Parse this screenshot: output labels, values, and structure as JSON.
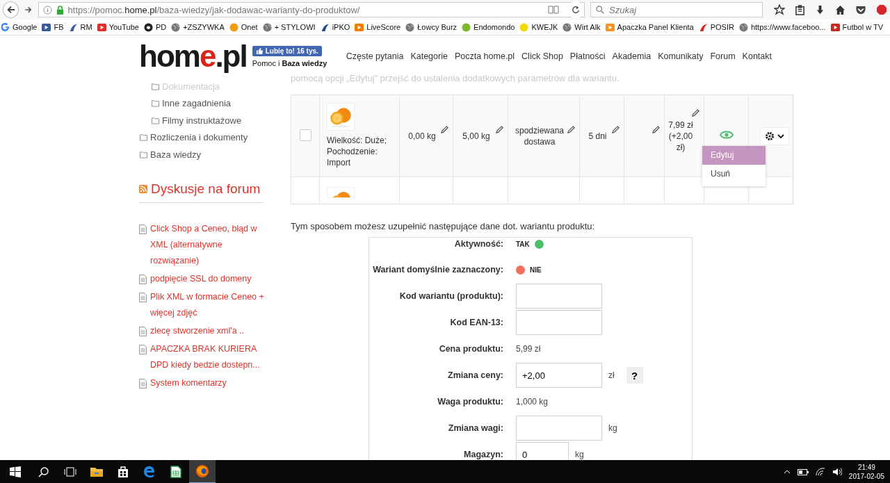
{
  "browser": {
    "url": {
      "prefix": "https://pomoc.",
      "host": "home.pl",
      "path": "/baza-wiedzy/jak-dodawac-warianty-do-produktow/"
    },
    "search": {
      "placeholder": "Szukaj"
    },
    "bookmarks": [
      {
        "label": "Google",
        "kind": "google",
        "color": "#4285f4"
      },
      {
        "label": "FB",
        "kind": "square",
        "color": "#3b5998"
      },
      {
        "label": "RM",
        "kind": "figure",
        "color": "#3a5aa8"
      },
      {
        "label": "YouTube",
        "kind": "square",
        "color": "#e52d27"
      },
      {
        "label": "PD",
        "kind": "ball",
        "color": "#222222"
      },
      {
        "label": "+ZSZYWKA",
        "kind": "globe"
      },
      {
        "label": "Onet",
        "kind": "dot",
        "color": "#f39c12"
      },
      {
        "label": "+ STYLOWI",
        "kind": "globe"
      },
      {
        "label": "iPKO",
        "kind": "figure",
        "color": "#1d4b8f"
      },
      {
        "label": "LiveScore",
        "kind": "square",
        "color": "#f07d00"
      },
      {
        "label": "Łowcy Burz",
        "kind": "globe"
      },
      {
        "label": "Endomondo",
        "kind": "dot",
        "color": "#7ab929"
      },
      {
        "label": "KWEJK",
        "kind": "dot",
        "color": "#f5d80c"
      },
      {
        "label": "Wirt Alk",
        "kind": "globe"
      },
      {
        "label": "Apaczka Panel Klienta",
        "kind": "square",
        "color": "#f7931e"
      },
      {
        "label": "POSIR",
        "kind": "figure",
        "color": "#d9261c"
      },
      {
        "label": "https://www.faceboo...",
        "kind": "globe"
      },
      {
        "label": "Futbol w TV",
        "kind": "square",
        "color": "#c8281e"
      }
    ]
  },
  "header": {
    "logo": [
      {
        "text": "hom",
        "accent": false
      },
      {
        "text": "e",
        "accent": true
      },
      {
        "text": ".pl",
        "accent": false
      }
    ],
    "like": "Lubię to! 16 tys.",
    "tagline": "Pomoc i **Baza wiedzy**",
    "nav": [
      "Częste pytania",
      "Kategorie",
      "Poczta home.pl",
      "Click Shop",
      "Płatności",
      "Akademia",
      "Komunikaty",
      "Forum",
      "Kontakt"
    ]
  },
  "sidebar": {
    "categories": [
      {
        "label": "Dokumentacja",
        "faded": true,
        "sub": true
      },
      {
        "label": "Inne zagadnienia",
        "faded": false,
        "sub": true
      },
      {
        "label": "Filmy instruktażowe",
        "faded": false,
        "sub": true
      },
      {
        "label": "Rozliczenia i dokumenty",
        "faded": false,
        "sub": false
      },
      {
        "label": "Baza wiedzy",
        "faded": false,
        "sub": false
      }
    ],
    "forum_title": "Dyskusje na forum",
    "forum_links": [
      "Click Shop a Ceneo, błąd w XML (alternatywne rozwiązanie)",
      "podpięcie SSL do domeny",
      "Plik XML w formacie Ceneo + więcej zdjęć",
      "zlecę stworzenie xml'a ..",
      "APACZKA BRAK KURIERA DPD kiedy bedzie dostepn...",
      "System komentarzy"
    ]
  },
  "article": {
    "intro_tail": "pomocą opcji „Edytuj” przejść do ustalenia dodatkowych parametrów dla wariantu.",
    "variants": [
      {
        "kind": "full",
        "checked": false,
        "attributes": "Wielkość: Duże; Pochodzenie: Import",
        "weight": "0,00 kg",
        "weight_total": "5,00 kg",
        "availability": "spodziewana dostawa",
        "shipping": "5 dni",
        "price": "7,99 zł (+2,00 zł)",
        "visible": true
      },
      {
        "kind": "partial"
      }
    ],
    "menu": [
      {
        "label": "Edytuj",
        "selected": true
      },
      {
        "label": "Usuń",
        "selected": false
      }
    ],
    "lead": "Tym sposobem możesz uzupełnić następujące dane dot. wariantu produktu:",
    "form": [
      {
        "kind": "status",
        "label": "Aktywność:",
        "value": "TAK",
        "on": true
      },
      {
        "kind": "status",
        "label": "Wariant domyślnie zaznaczony:",
        "value": "NIE",
        "on": false
      },
      {
        "kind": "input",
        "label": "Kod wariantu (produktu):"
      },
      {
        "kind": "input",
        "label": "Kod EAN-13:"
      },
      {
        "kind": "value",
        "label": "Cena produktu:",
        "value": "5,99 zł"
      },
      {
        "kind": "input",
        "label": "Zmiana ceny:",
        "value": "+2,00",
        "unit": "zł",
        "help": "?"
      },
      {
        "kind": "value",
        "label": "Waga produktu:",
        "value": "1,000 kg"
      },
      {
        "kind": "input",
        "label": "Zmiana wagi:",
        "unit": "kg"
      },
      {
        "kind": "input",
        "label": "Magazyn:",
        "value": "0",
        "unit": "kg",
        "small": true
      }
    ]
  },
  "taskbar": {
    "apps": [
      {
        "kind": "search",
        "selected": false
      },
      {
        "kind": "taskview",
        "selected": false
      },
      {
        "kind": "folder",
        "selected": false
      },
      {
        "kind": "store",
        "selected": false
      },
      {
        "kind": "edge",
        "selected": false
      },
      {
        "kind": "sheet",
        "selected": false
      },
      {
        "kind": "firefox",
        "selected": true
      }
    ],
    "time": "21:49",
    "date": "2017-02-05"
  }
}
